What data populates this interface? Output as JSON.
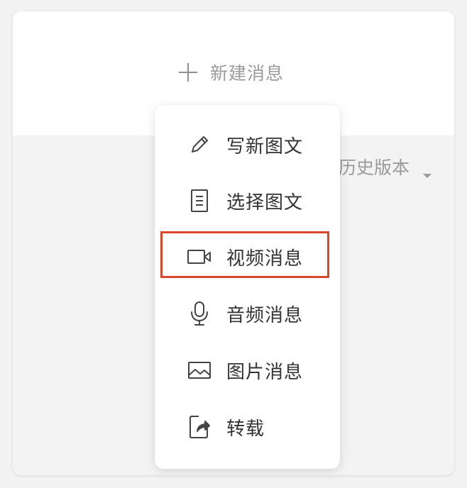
{
  "header": {
    "new_message_label": "新建消息"
  },
  "toolbar": {
    "history_label": "文历史版本"
  },
  "menu": {
    "items": [
      {
        "label": "写新图文",
        "icon": "pencil-icon"
      },
      {
        "label": "选择图文",
        "icon": "document-icon"
      },
      {
        "label": "视频消息",
        "icon": "video-camera-icon"
      },
      {
        "label": "音频消息",
        "icon": "microphone-icon"
      },
      {
        "label": "图片消息",
        "icon": "image-icon"
      },
      {
        "label": "转载",
        "icon": "share-icon"
      }
    ],
    "highlighted_item": "视频消息"
  },
  "colors": {
    "highlight_border": "#d9482b",
    "text_primary": "#333333",
    "text_muted": "#9a9a9a"
  }
}
